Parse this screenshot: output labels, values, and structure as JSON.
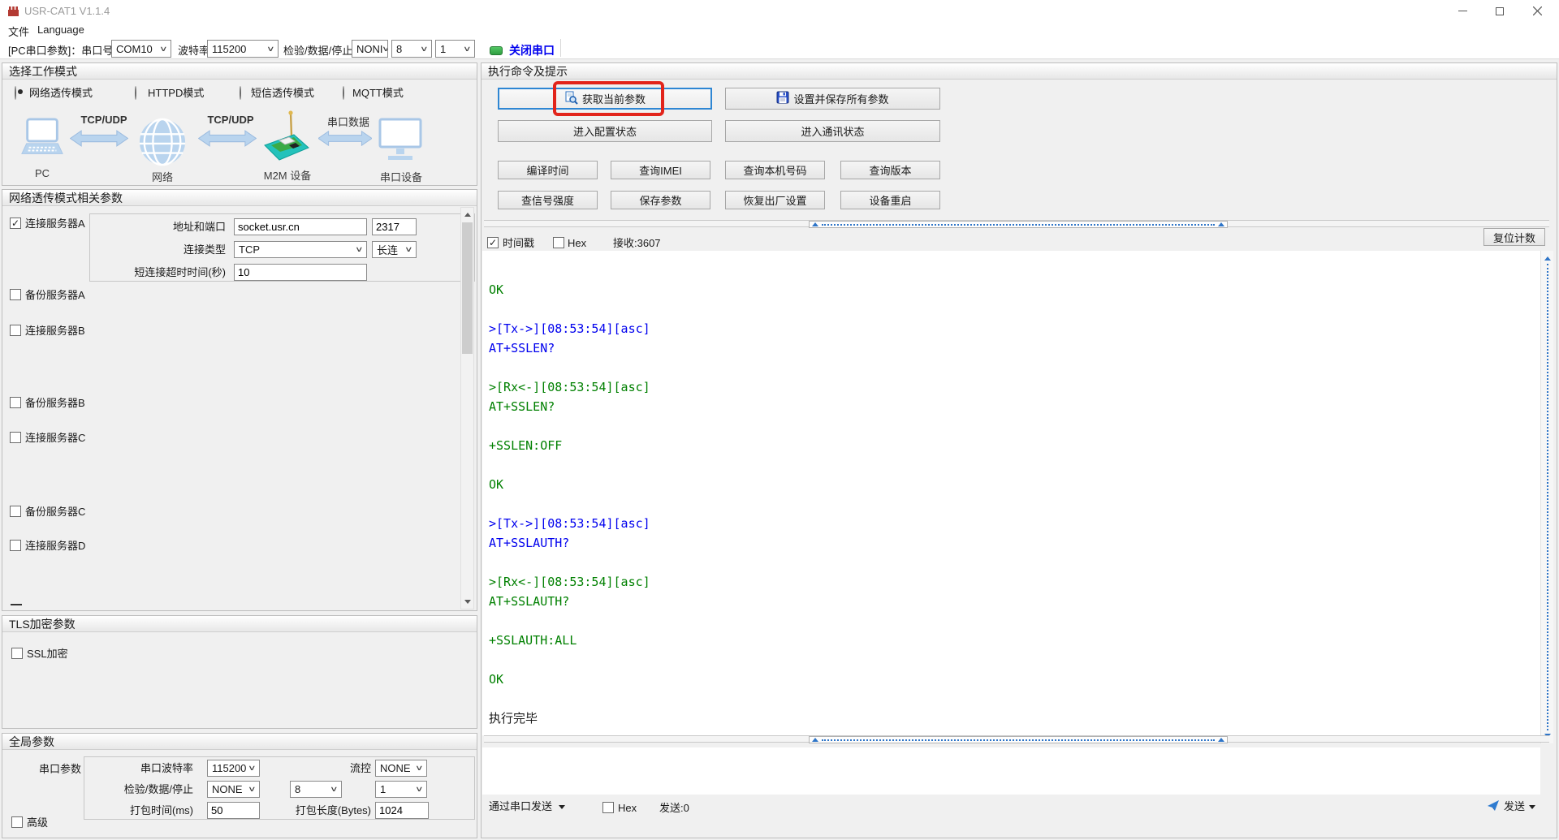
{
  "window": {
    "title": "USR-CAT1 V1.1.4"
  },
  "menu": {
    "items": [
      "文件",
      "Language"
    ]
  },
  "toolbar": {
    "port_label": "[PC串口参数]：串口号",
    "port_value": "COM10",
    "baud_label": "波特率",
    "baud_value": "115200",
    "line_label": "检验/数据/停止",
    "parity_value": "NONI",
    "data_value": "8",
    "stop_value": "1",
    "close_button": "关闭串口"
  },
  "work_mode": {
    "title": "选择工作模式",
    "options": [
      {
        "label": "网络透传模式",
        "selected": true
      },
      {
        "label": "HTTPD模式",
        "selected": false
      },
      {
        "label": "短信透传模式",
        "selected": false
      },
      {
        "label": "MQTT模式",
        "selected": false
      }
    ],
    "diagram": {
      "pc": "PC",
      "net": "网络",
      "m2m": "M2M 设备",
      "serial_dev": "串口设备",
      "link1": "TCP/UDP",
      "link2": "TCP/UDP",
      "link3": "串口数据"
    }
  },
  "net_params": {
    "title": "网络透传模式相关参数",
    "server_a": "连接服务器A",
    "addr_label": "地址和端口",
    "addr_value": "socket.usr.cn",
    "port_value": "2317",
    "type_label": "连接类型",
    "type_value": "TCP",
    "keep_value": "长连",
    "timeout_label": "短连接超时时间(秒)",
    "timeout_value": "10",
    "others": [
      "备份服务器A",
      "连接服务器B",
      "备份服务器B",
      "连接服务器C",
      "备份服务器C",
      "连接服务器D"
    ]
  },
  "tls": {
    "title": "TLS加密参数",
    "ssl": "SSL加密"
  },
  "global_params": {
    "title": "全局参数",
    "group_label": "串口参数",
    "baud_label": "串口波特率",
    "baud_value": "115200",
    "flow_label": "流控",
    "flow_value": "NONE",
    "line_label": "检验/数据/停止",
    "parity_value": "NONE",
    "data_value": "8",
    "stop_value": "1",
    "pack_time_label": "打包时间(ms)",
    "pack_time_value": "50",
    "pack_len_label": "打包长度(Bytes)",
    "pack_len_value": "1024",
    "advanced": "高级"
  },
  "cmd": {
    "title": "执行命令及提示",
    "get_params": "获取当前参数",
    "set_save": "设置并保存所有参数",
    "enter_config": "进入配置状态",
    "enter_comm": "进入通讯状态",
    "small": [
      "编译时间",
      "查询IMEI",
      "查询本机号码",
      "查询版本",
      "查信号强度",
      "保存参数",
      "恢复出厂设置",
      "设备重启"
    ]
  },
  "log": {
    "timestamp": "时间戳",
    "hex": "Hex",
    "recv": "接收:3607",
    "reset": "复位计数",
    "lines": [
      {
        "t": "",
        "c": "lk"
      },
      {
        "t": "OK",
        "c": "lg"
      },
      {
        "t": "",
        "c": "lk"
      },
      {
        "t": ">[Tx->][08:53:54][asc]",
        "c": "lb"
      },
      {
        "t": "AT+SSLEN?",
        "c": "lb"
      },
      {
        "t": "",
        "c": "lk"
      },
      {
        "t": ">[Rx<-][08:53:54][asc]",
        "c": "lg"
      },
      {
        "t": "AT+SSLEN?",
        "c": "lg"
      },
      {
        "t": "",
        "c": "lk"
      },
      {
        "t": "+SSLEN:OFF",
        "c": "lg"
      },
      {
        "t": "",
        "c": "lk"
      },
      {
        "t": "OK",
        "c": "lg"
      },
      {
        "t": "",
        "c": "lk"
      },
      {
        "t": ">[Tx->][08:53:54][asc]",
        "c": "lb"
      },
      {
        "t": "AT+SSLAUTH?",
        "c": "lb"
      },
      {
        "t": "",
        "c": "lk"
      },
      {
        "t": ">[Rx<-][08:53:54][asc]",
        "c": "lg"
      },
      {
        "t": "AT+SSLAUTH?",
        "c": "lg"
      },
      {
        "t": "",
        "c": "lk"
      },
      {
        "t": "+SSLAUTH:ALL",
        "c": "lg"
      },
      {
        "t": "",
        "c": "lk"
      },
      {
        "t": "OK",
        "c": "lg"
      },
      {
        "t": "",
        "c": "lk"
      },
      {
        "t": "执行完毕",
        "c": "lk"
      }
    ]
  },
  "send": {
    "via": "通过串口发送",
    "hex": "Hex",
    "sent": "发送:0",
    "button": "发送"
  },
  "colors": {
    "link_blue": "#0000ee",
    "log_green": "#008000",
    "annotation_red": "#e2241b",
    "port_open_green": "#3cb44a"
  }
}
